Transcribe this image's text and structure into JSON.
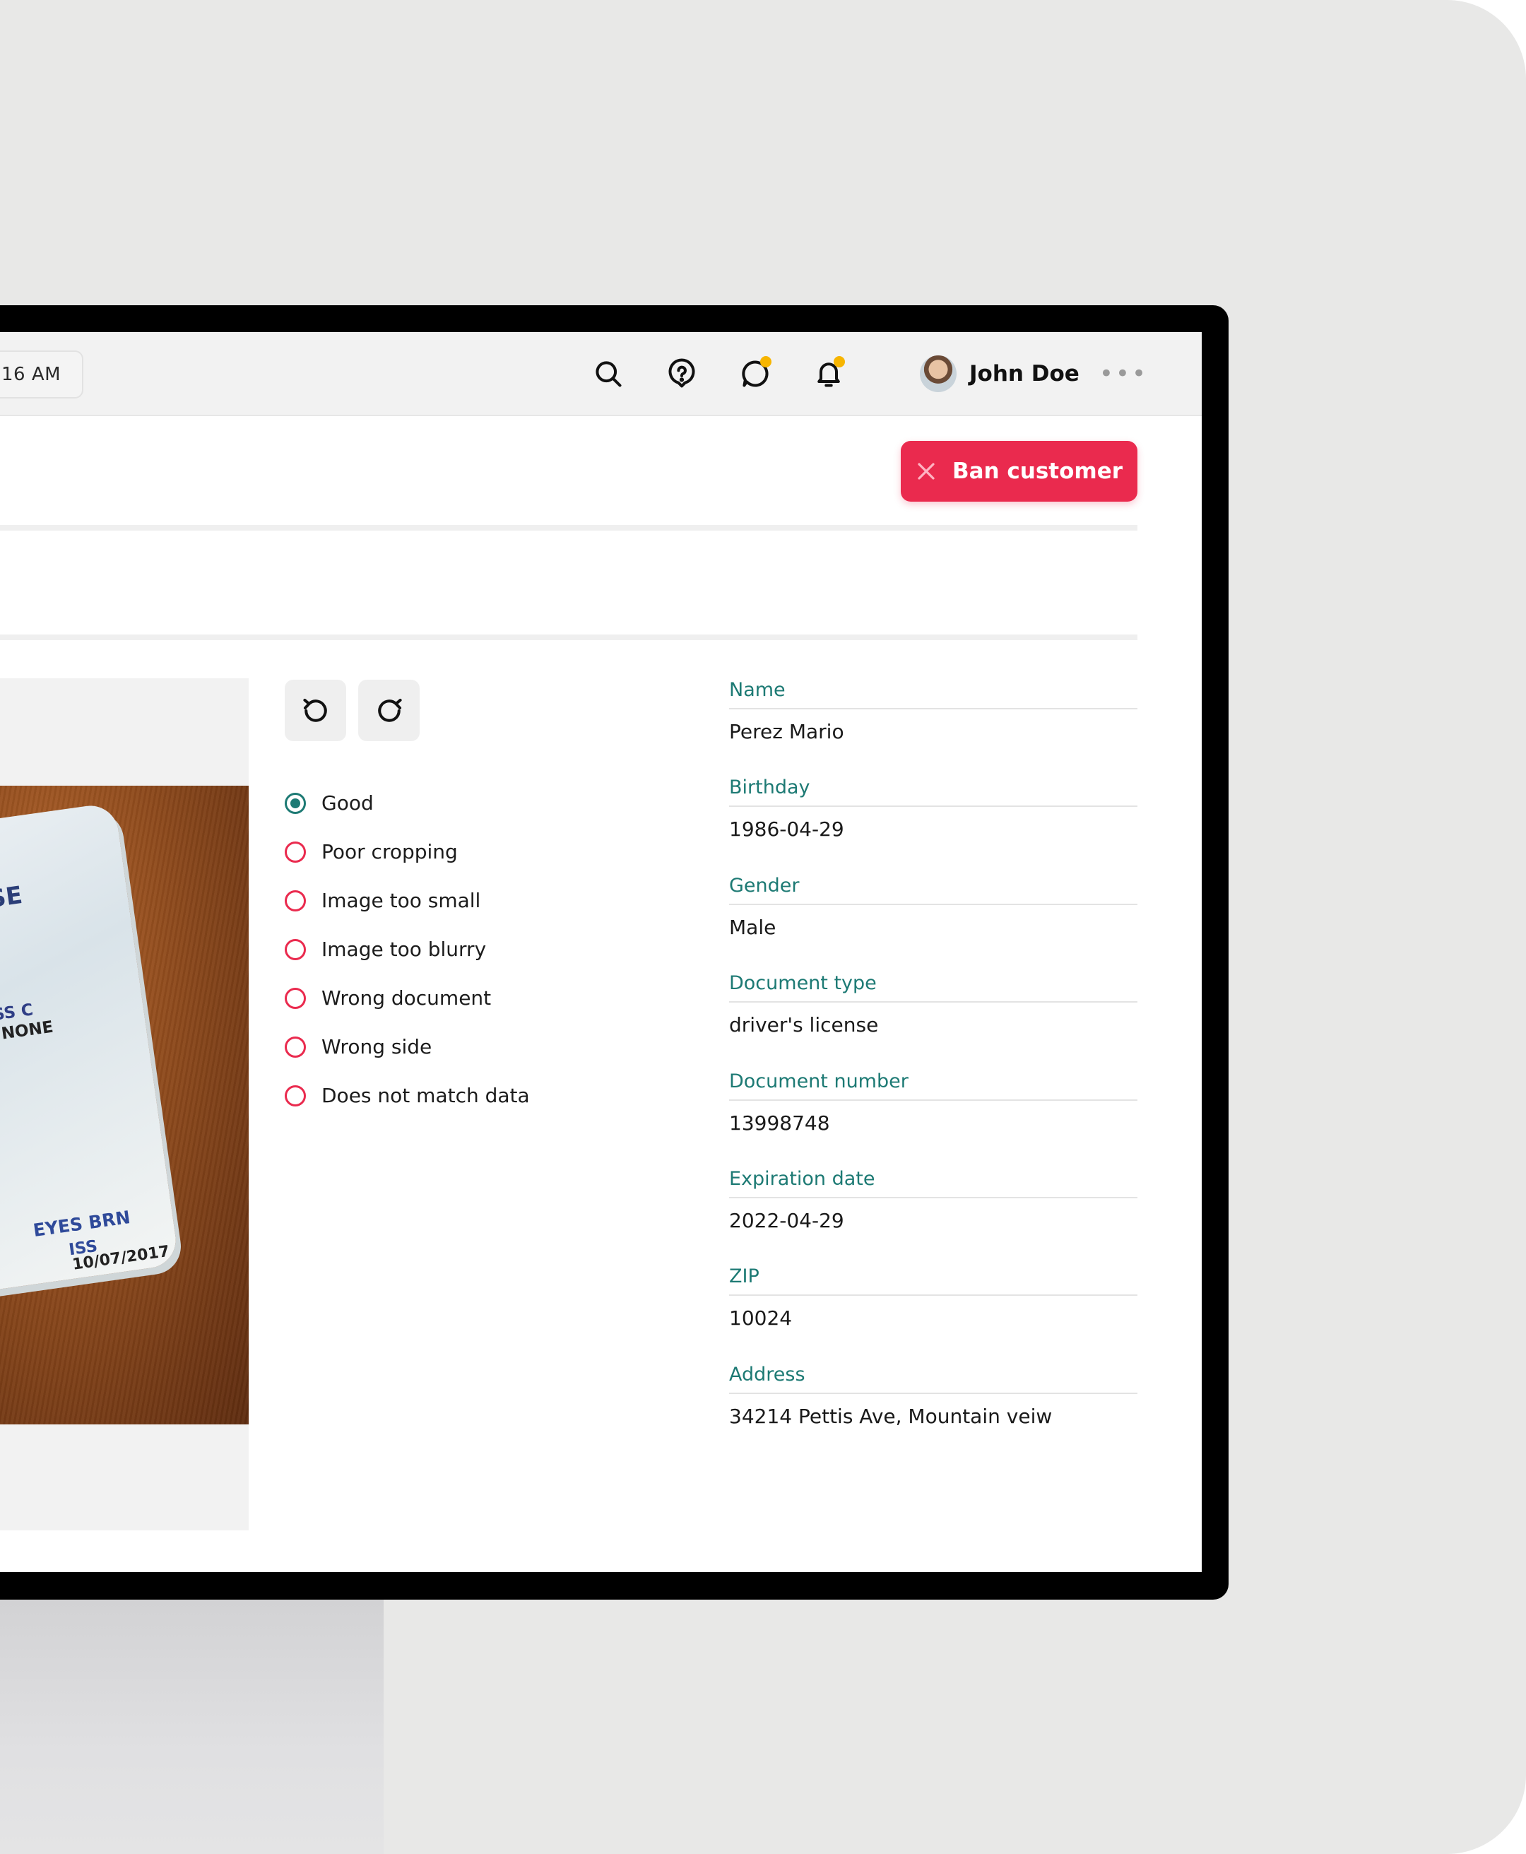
{
  "header": {
    "time_text": "16 AM",
    "user_name": "John Doe",
    "more_label": "•••",
    "icons": [
      "search-icon",
      "help-icon",
      "chat-icon",
      "bell-icon"
    ],
    "notification_dot_color": "#f7b500"
  },
  "actions": {
    "ban_label": "Ban customer",
    "ban_color": "#ea2a4e"
  },
  "document_image": {
    "card_text": {
      "title_fragment": "ISE",
      "class_line": "SS  C",
      "restrictions": "NONE",
      "eyes": "EYES BRN",
      "iss_label": "ISS",
      "iss_date": "10/07/2017"
    }
  },
  "review": {
    "options": [
      {
        "label": "Good",
        "checked": true
      },
      {
        "label": "Poor cropping",
        "checked": false
      },
      {
        "label": "Image too small",
        "checked": false
      },
      {
        "label": "Image too blurry",
        "checked": false
      },
      {
        "label": "Wrong document",
        "checked": false
      },
      {
        "label": "Wrong side",
        "checked": false
      },
      {
        "label": "Does not match data",
        "checked": false
      }
    ]
  },
  "details": {
    "fields": [
      {
        "label": "Name",
        "value": "Perez Mario"
      },
      {
        "label": "Birthday",
        "value": "1986-04-29"
      },
      {
        "label": "Gender",
        "value": "Male"
      },
      {
        "label": "Document type",
        "value": "driver's license"
      },
      {
        "label": "Document number",
        "value": "13998748"
      },
      {
        "label": "Expiration date",
        "value": "2022-04-29"
      },
      {
        "label": "ZIP",
        "value": "10024"
      },
      {
        "label": "Address",
        "value": "34214 Pettis Ave, Mountain veiw"
      }
    ]
  },
  "colors": {
    "accent": "#1d7a74",
    "danger": "#ea2a4e"
  }
}
